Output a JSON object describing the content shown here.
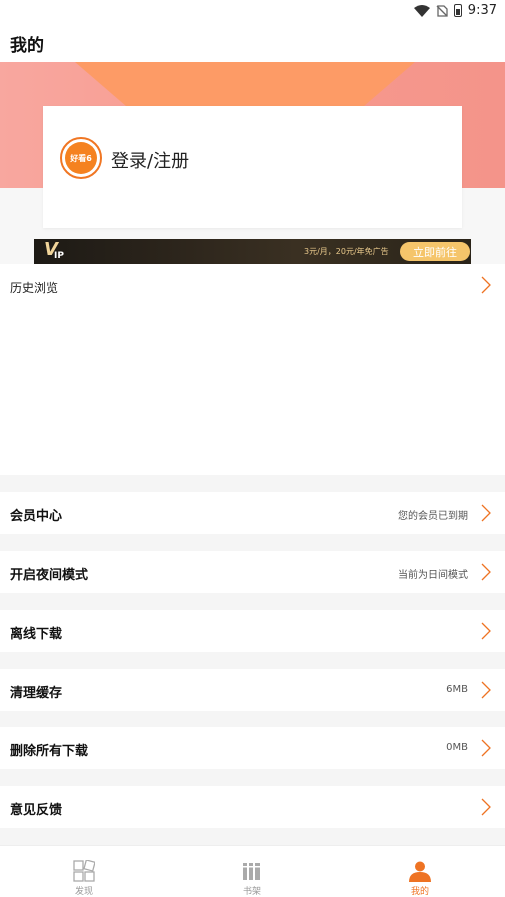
{
  "status_bar": {
    "time": "9:37"
  },
  "app_bar": {
    "title": "我的"
  },
  "login": {
    "avatar_text": "好看6",
    "label": "登录/注册"
  },
  "vip_banner": {
    "logo_v": "V",
    "logo_ip": "IP",
    "promo": "3元/月，20元/年免广告",
    "button": "立即前往"
  },
  "history": {
    "title": "历史浏览"
  },
  "menu": [
    {
      "label": "会员中心",
      "value": "您的会员已到期"
    },
    {
      "label": "开启夜间模式",
      "value": "当前为日间模式"
    },
    {
      "label": "离线下载",
      "value": ""
    },
    {
      "label": "清理缓存",
      "value": "6MB"
    },
    {
      "label": "删除所有下载",
      "value": "0MB"
    },
    {
      "label": "意见反馈",
      "value": ""
    }
  ],
  "bottom_nav": [
    {
      "label": "发现",
      "active": false
    },
    {
      "label": "书架",
      "active": false
    },
    {
      "label": "我的",
      "active": true
    }
  ],
  "colors": {
    "accent": "#ee7323",
    "header_pink": "#f79a8e",
    "header_orange": "#fd9b66",
    "vip_gold": "#f5c56b"
  }
}
